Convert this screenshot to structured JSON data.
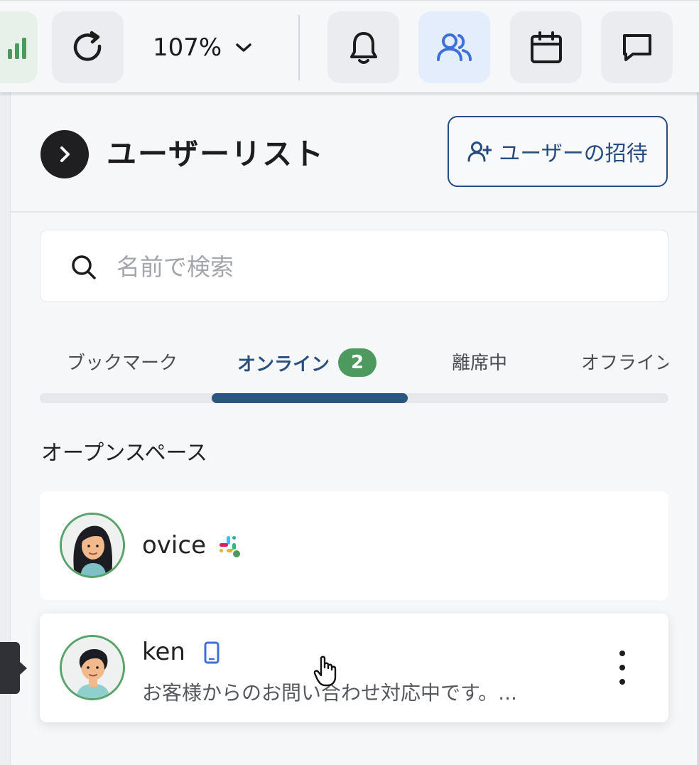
{
  "toolbar": {
    "zoom_label": "107%",
    "buttons": [
      "stats",
      "refresh",
      "notifications",
      "users",
      "calendar",
      "chat"
    ],
    "active_button": "users"
  },
  "panel": {
    "title": "ユーザーリスト",
    "invite_label": "ユーザーの招待"
  },
  "search": {
    "placeholder": "名前で検索",
    "value": ""
  },
  "tabs": [
    {
      "label": "ブックマーク"
    },
    {
      "label": "オンライン",
      "badge": "2",
      "active": true
    },
    {
      "label": "離席中"
    },
    {
      "label": "オフライン"
    }
  ],
  "section": {
    "label": "オープンスペース"
  },
  "users": [
    {
      "name": "ovice",
      "status_icon": "slack-icon",
      "status_text": ""
    },
    {
      "name": "ken",
      "status_icon": "mobile-icon",
      "status_text": "お客様からのお問い合わせ対応中です。..."
    }
  ],
  "colors": {
    "accent": "#2c5682",
    "online_green": "#4e9a5e",
    "active_icon_blue": "#3f6fd8"
  }
}
